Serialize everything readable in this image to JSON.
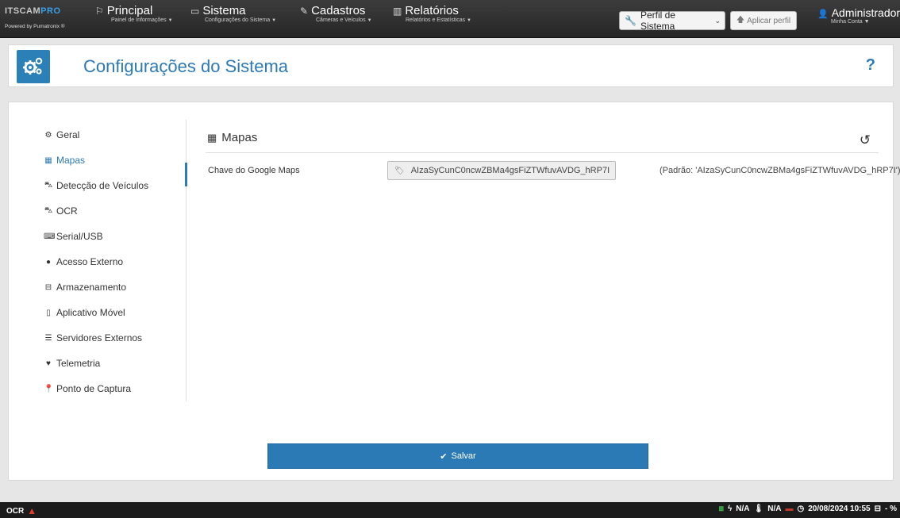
{
  "logo": {
    "brand": "ITSCAM",
    "brand_suffix": "PRO",
    "powered_by": "Powered by Pumatronix ®"
  },
  "nav": [
    {
      "label": "Principal",
      "sub": "Painel de Informações",
      "icon": "flag-icon"
    },
    {
      "label": "Sistema",
      "sub": "Configurações do Sistema",
      "icon": "monitor-icon"
    },
    {
      "label": "Cadastros",
      "sub": "Câmeras e Veículos",
      "icon": "edit-icon"
    },
    {
      "label": "Relatórios",
      "sub": "Relatórios e Estatísticas",
      "icon": "bar-chart-icon"
    }
  ],
  "perfil": {
    "selected": "Perfil de Sistema",
    "apply_label": "Aplicar perfil"
  },
  "user": {
    "name": "Administrador",
    "sub": "Minha Conta"
  },
  "header": {
    "title": "Configurações do Sistema",
    "help": "?"
  },
  "sidebar": {
    "items": [
      {
        "label": "Geral",
        "icon": "gears-icon"
      },
      {
        "label": "Mapas",
        "icon": "map-icon",
        "active": true
      },
      {
        "label": "Detecção de Veículos",
        "icon": "car-icon"
      },
      {
        "label": "OCR",
        "icon": "car-icon"
      },
      {
        "label": "Serial/USB",
        "icon": "serial-icon"
      },
      {
        "label": "Acesso Externo",
        "icon": "globe-icon"
      },
      {
        "label": "Armazenamento",
        "icon": "hdd-icon"
      },
      {
        "label": "Aplicativo Móvel",
        "icon": "mobile-icon"
      },
      {
        "label": "Servidores Externos",
        "icon": "server-icon"
      },
      {
        "label": "Telemetria",
        "icon": "heartbeat-icon"
      },
      {
        "label": "Ponto de Captura",
        "icon": "pin-icon"
      }
    ]
  },
  "section": {
    "title": "Mapas",
    "field_label": "Chave do Google Maps",
    "field_value": "AIzaSyCunC0ncwZBMa4gsFiZTWfuvAVDG_hRP7I",
    "field_default": "(Padrão: 'AIzaSyCunC0ncwZBMa4gsFiZTWfuvAVDG_hRP7I')"
  },
  "save_label": "Salvar",
  "status": {
    "left_label": "OCR",
    "val1": "N/A",
    "val2": "N/A",
    "datetime": "20/08/2024 10:55",
    "storage": "- %"
  },
  "colors": {
    "accent": "#2b7ab5",
    "topbar": "#2f2f2f",
    "warning": "#e03c2c"
  }
}
